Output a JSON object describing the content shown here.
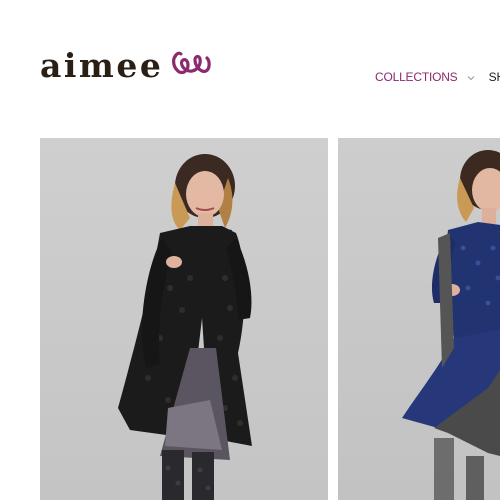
{
  "brand": {
    "name": "aimee",
    "logo_mark_icon": "loop-mark-icon",
    "text_color": "#2a1f14",
    "accent_color": "#8b2a6e"
  },
  "nav": {
    "items": [
      {
        "label": "COLLECTIONS",
        "has_dropdown": true,
        "color": "#8b2a6e"
      },
      {
        "label": "SHO",
        "has_dropdown": false,
        "color": "#1e1e1e"
      }
    ]
  },
  "gallery": {
    "products": [
      {
        "image": "model-black-coat-photo"
      },
      {
        "image": "model-blue-dress-photo"
      }
    ]
  }
}
